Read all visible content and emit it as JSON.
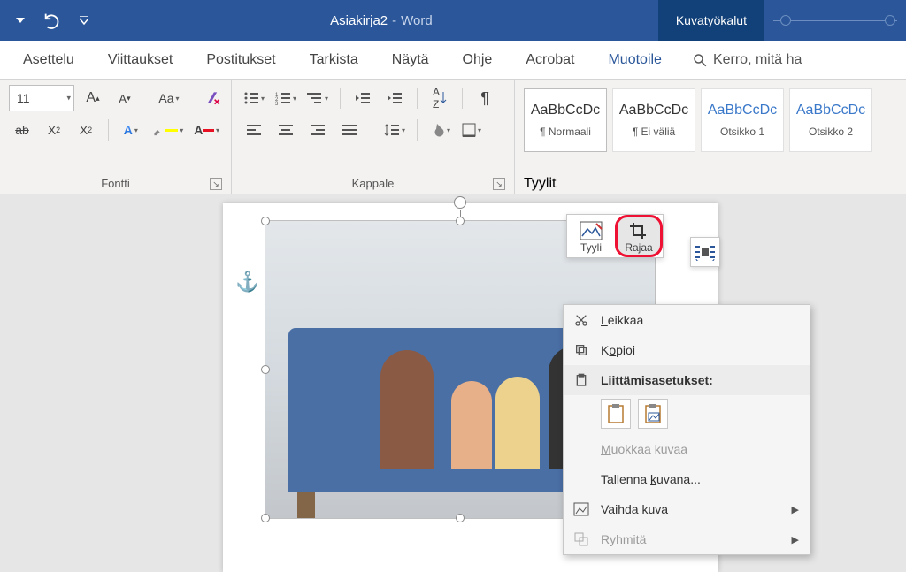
{
  "title": {
    "doc": "Asiakirja2",
    "app": "Word",
    "tool_tab": "Kuvatyökalut"
  },
  "tabs": [
    "Asettelu",
    "Viittaukset",
    "Postitukset",
    "Tarkista",
    "Näytä",
    "Ohje",
    "Acrobat",
    "Muotoile"
  ],
  "tell_me": "Kerro, mitä ha",
  "font": {
    "size_value": "11",
    "group_label": "Fontti"
  },
  "paragraph": {
    "group_label": "Kappale"
  },
  "styles": {
    "group_label": "Tyylit",
    "items": [
      {
        "sample": "AaBbCcDc",
        "name": "¶ Normaali"
      },
      {
        "sample": "AaBbCcDc",
        "name": "¶ Ei väliä"
      },
      {
        "sample": "AaBbCcDc",
        "name": "Otsikko 1"
      },
      {
        "sample": "AaBbCcDc",
        "name": "Otsikko 2"
      }
    ]
  },
  "mini_toolbar": {
    "style": "Tyyli",
    "crop": "Rajaa"
  },
  "context_menu": {
    "cut": "Leikkaa",
    "copy": "Kopioi",
    "paste_header": "Liittämisasetukset:",
    "edit_image": "Muokkaa kuvaa",
    "save_as_image": "Tallenna kuvana...",
    "change_image": "Vaihda kuva",
    "group": "Ryhmitä"
  }
}
